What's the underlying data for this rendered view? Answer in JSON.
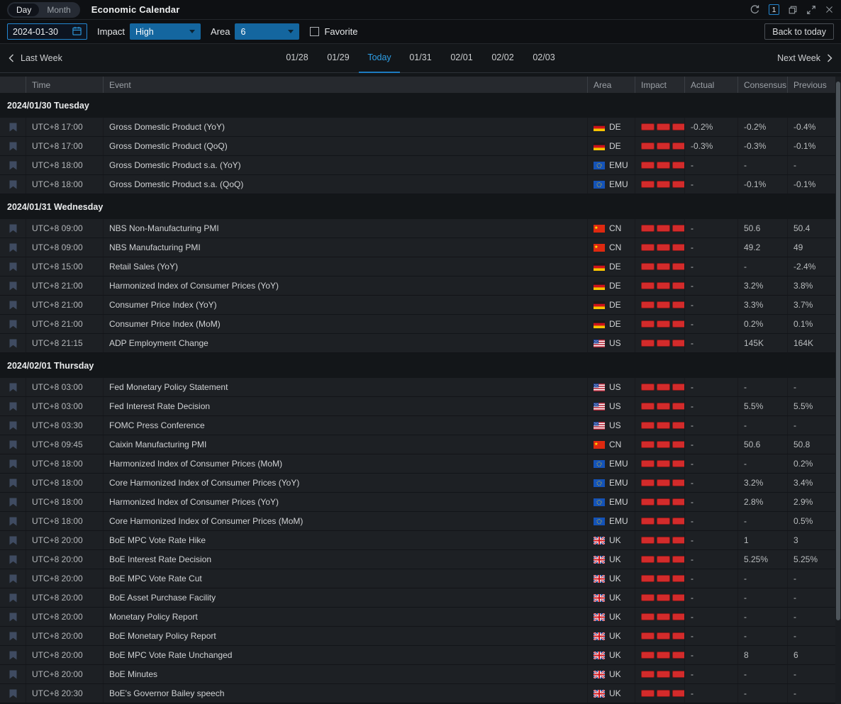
{
  "titlebar": {
    "tabs": [
      {
        "label": "Day"
      },
      {
        "label": "Month"
      }
    ],
    "active_tab": "Day",
    "title": "Economic Calendar",
    "panel_count": "1",
    "icons": [
      "refresh-icon",
      "panel-count-badge",
      "restore-window-icon",
      "expand-icon",
      "close-icon"
    ]
  },
  "filters": {
    "date_value": "2024-01-30",
    "impact_label": "Impact",
    "impact_value": "High",
    "area_label": "Area",
    "area_value": "6",
    "favorite_label": "Favorite",
    "favorite_checked": false,
    "back_to_today_label": "Back to today"
  },
  "week_nav": {
    "prev_label": "Last Week",
    "next_label": "Next Week",
    "days": [
      "01/28",
      "01/29",
      "Today",
      "01/31",
      "02/01",
      "02/02",
      "02/03"
    ],
    "active_day": "Today"
  },
  "table": {
    "columns": [
      "Time",
      "Event",
      "Area",
      "Impact",
      "Actual",
      "Consensus",
      "Previous"
    ],
    "groups": [
      {
        "date": "2024/01/30 Tuesday",
        "rows": [
          {
            "time": "UTC+8 17:00",
            "event": "Gross Domestic Product (YoY)",
            "area": "DE",
            "impact": 3,
            "actual": "-0.2%",
            "consensus": "-0.2%",
            "previous": "-0.4%"
          },
          {
            "time": "UTC+8 17:00",
            "event": "Gross Domestic Product (QoQ)",
            "area": "DE",
            "impact": 3,
            "actual": "-0.3%",
            "consensus": "-0.3%",
            "previous": "-0.1%"
          },
          {
            "time": "UTC+8 18:00",
            "event": "Gross Domestic Product s.a. (YoY)",
            "area": "EMU",
            "impact": 3,
            "actual": "-",
            "consensus": "-",
            "previous": "-"
          },
          {
            "time": "UTC+8 18:00",
            "event": "Gross Domestic Product s.a. (QoQ)",
            "area": "EMU",
            "impact": 3,
            "actual": "-",
            "consensus": "-0.1%",
            "previous": "-0.1%"
          }
        ]
      },
      {
        "date": "2024/01/31 Wednesday",
        "rows": [
          {
            "time": "UTC+8 09:00",
            "event": "NBS Non-Manufacturing PMI",
            "area": "CN",
            "impact": 3,
            "actual": "-",
            "consensus": "50.6",
            "previous": "50.4"
          },
          {
            "time": "UTC+8 09:00",
            "event": "NBS Manufacturing PMI",
            "area": "CN",
            "impact": 3,
            "actual": "-",
            "consensus": "49.2",
            "previous": "49"
          },
          {
            "time": "UTC+8 15:00",
            "event": "Retail Sales (YoY)",
            "area": "DE",
            "impact": 3,
            "actual": "-",
            "consensus": "-",
            "previous": "-2.4%"
          },
          {
            "time": "UTC+8 21:00",
            "event": "Harmonized Index of Consumer Prices (YoY)",
            "area": "DE",
            "impact": 3,
            "actual": "-",
            "consensus": "3.2%",
            "previous": "3.8%"
          },
          {
            "time": "UTC+8 21:00",
            "event": "Consumer Price Index (YoY)",
            "area": "DE",
            "impact": 3,
            "actual": "-",
            "consensus": "3.3%",
            "previous": "3.7%"
          },
          {
            "time": "UTC+8 21:00",
            "event": "Consumer Price Index (MoM)",
            "area": "DE",
            "impact": 3,
            "actual": "-",
            "consensus": "0.2%",
            "previous": "0.1%"
          },
          {
            "time": "UTC+8 21:15",
            "event": "ADP Employment Change",
            "area": "US",
            "impact": 3,
            "actual": "-",
            "consensus": "145K",
            "previous": "164K"
          }
        ]
      },
      {
        "date": "2024/02/01 Thursday",
        "rows": [
          {
            "time": "UTC+8 03:00",
            "event": "Fed Monetary Policy Statement",
            "area": "US",
            "impact": 3,
            "actual": "-",
            "consensus": "-",
            "previous": "-"
          },
          {
            "time": "UTC+8 03:00",
            "event": "Fed Interest Rate Decision",
            "area": "US",
            "impact": 3,
            "actual": "-",
            "consensus": "5.5%",
            "previous": "5.5%"
          },
          {
            "time": "UTC+8 03:30",
            "event": "FOMC Press Conference",
            "area": "US",
            "impact": 3,
            "actual": "-",
            "consensus": "-",
            "previous": "-"
          },
          {
            "time": "UTC+8 09:45",
            "event": "Caixin Manufacturing PMI",
            "area": "CN",
            "impact": 3,
            "actual": "-",
            "consensus": "50.6",
            "previous": "50.8"
          },
          {
            "time": "UTC+8 18:00",
            "event": "Harmonized Index of Consumer Prices (MoM)",
            "area": "EMU",
            "impact": 3,
            "actual": "-",
            "consensus": "-",
            "previous": "0.2%"
          },
          {
            "time": "UTC+8 18:00",
            "event": "Core Harmonized Index of Consumer Prices (YoY)",
            "area": "EMU",
            "impact": 3,
            "actual": "-",
            "consensus": "3.2%",
            "previous": "3.4%"
          },
          {
            "time": "UTC+8 18:00",
            "event": "Harmonized Index of Consumer Prices (YoY)",
            "area": "EMU",
            "impact": 3,
            "actual": "-",
            "consensus": "2.8%",
            "previous": "2.9%"
          },
          {
            "time": "UTC+8 18:00",
            "event": "Core Harmonized Index of Consumer Prices (MoM)",
            "area": "EMU",
            "impact": 3,
            "actual": "-",
            "consensus": "-",
            "previous": "0.5%"
          },
          {
            "time": "UTC+8 20:00",
            "event": "BoE MPC Vote Rate Hike",
            "area": "UK",
            "impact": 3,
            "actual": "-",
            "consensus": "1",
            "previous": "3"
          },
          {
            "time": "UTC+8 20:00",
            "event": "BoE Interest Rate Decision",
            "area": "UK",
            "impact": 3,
            "actual": "-",
            "consensus": "5.25%",
            "previous": "5.25%"
          },
          {
            "time": "UTC+8 20:00",
            "event": "BoE MPC Vote Rate Cut",
            "area": "UK",
            "impact": 3,
            "actual": "-",
            "consensus": "-",
            "previous": "-"
          },
          {
            "time": "UTC+8 20:00",
            "event": "BoE Asset Purchase Facility",
            "area": "UK",
            "impact": 3,
            "actual": "-",
            "consensus": "-",
            "previous": "-"
          },
          {
            "time": "UTC+8 20:00",
            "event": "Monetary Policy Report",
            "area": "UK",
            "impact": 3,
            "actual": "-",
            "consensus": "-",
            "previous": "-"
          },
          {
            "time": "UTC+8 20:00",
            "event": "BoE Monetary Policy Report",
            "area": "UK",
            "impact": 3,
            "actual": "-",
            "consensus": "-",
            "previous": "-"
          },
          {
            "time": "UTC+8 20:00",
            "event": "BoE MPC Vote Rate Unchanged",
            "area": "UK",
            "impact": 3,
            "actual": "-",
            "consensus": "8",
            "previous": "6"
          },
          {
            "time": "UTC+8 20:00",
            "event": "BoE Minutes",
            "area": "UK",
            "impact": 3,
            "actual": "-",
            "consensus": "-",
            "previous": "-"
          },
          {
            "time": "UTC+8 20:30",
            "event": "BoE's Governor Bailey speech",
            "area": "UK",
            "impact": 3,
            "actual": "-",
            "consensus": "-",
            "previous": "-"
          }
        ]
      }
    ]
  },
  "colors": {
    "accent_blue_fill": "#14669f",
    "accent_blue_border": "#2386d0",
    "today_blue": "#2e9fe6",
    "impact_red": "#d32b2b",
    "bookmark_gray_blue": "#3f4b61"
  }
}
